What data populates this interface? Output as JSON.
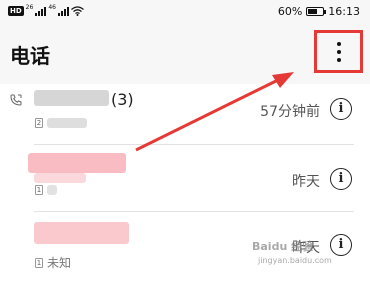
{
  "status_bar": {
    "network_left": "HD",
    "net_label_1": "26",
    "net_label_2": "46",
    "battery_percent": "60%",
    "battery_level": 0.6,
    "time": "16:13"
  },
  "app_bar": {
    "title": "电话",
    "more_icon": "more-vertical-icon"
  },
  "calls": [
    {
      "name_visible": "(3)",
      "sim": "2",
      "time": "57分钟前"
    },
    {
      "name_visible": "",
      "sim": "1",
      "time": "昨天"
    },
    {
      "name_visible": "",
      "sim": "1",
      "sub": "未知",
      "time": "昨天"
    }
  ],
  "colors": {
    "highlight": "#e53935",
    "blur_gray": "#d6d6d6",
    "blur_pink": "#f6a5ad"
  },
  "watermark": {
    "text": "Baidu 经验",
    "sub": "jingyan.baidu.com"
  }
}
